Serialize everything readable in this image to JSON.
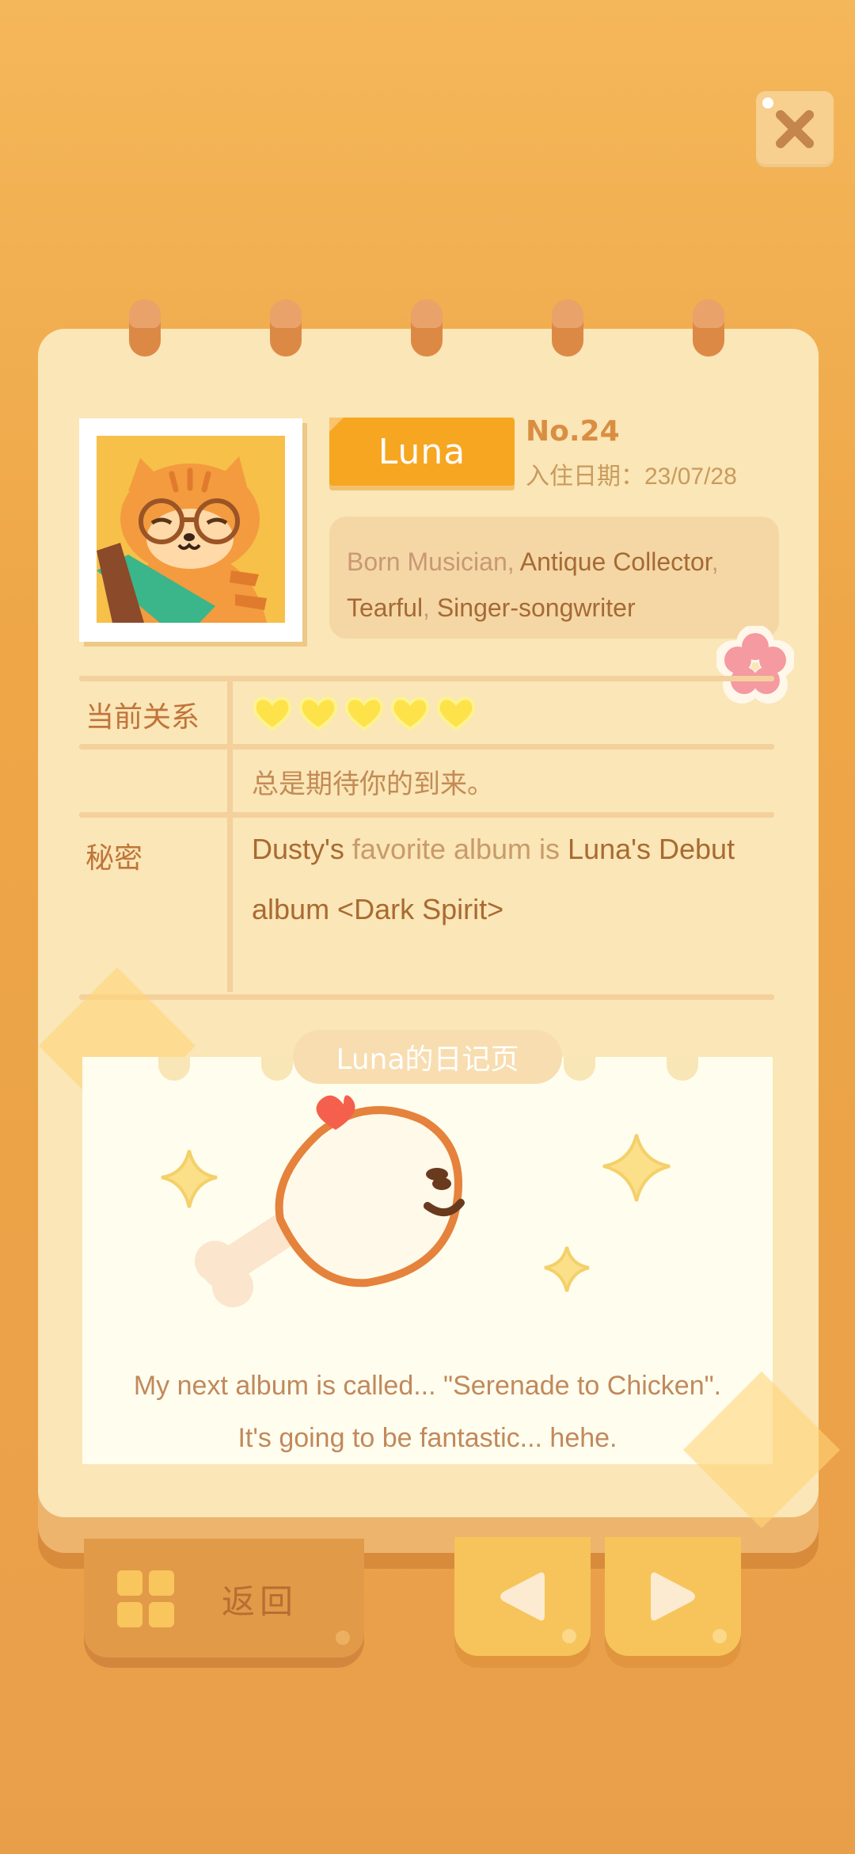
{
  "profile": {
    "name": "Luna",
    "number": "No.24",
    "checkin_label": "入住日期：23/07/28",
    "tags": [
      {
        "text": "Born Musician",
        "tone": "light"
      },
      {
        "text": "Antique Collector",
        "tone": "dark"
      },
      {
        "text": "Tearful",
        "tone": "dark"
      },
      {
        "text": "Singer-songwriter",
        "tone": "dark"
      }
    ]
  },
  "relationship": {
    "label": "当前关系",
    "hearts_filled": 5,
    "hearts_total": 5,
    "status": "总是期待你的到来。"
  },
  "secret": {
    "label": "秘密",
    "parts": [
      "Dusty's",
      "favorite album is",
      "Luna's Debut album <Dark Spirit>"
    ]
  },
  "diary": {
    "title": "Luna的日记页",
    "line1": "My next album is called... \"Serenade to Chicken\".",
    "line2": "It's going to be fantastic... hehe."
  },
  "buttons": {
    "back_label": "返回",
    "prev_icon": "triangle-left-icon",
    "next_icon": "triangle-right-icon",
    "close_icon": "close-icon",
    "menu_icon": "grid-icon"
  },
  "colors": {
    "background": "#eea647",
    "paper": "#fae6b6",
    "accent": "#f7a621",
    "heart": "#fde24a"
  }
}
